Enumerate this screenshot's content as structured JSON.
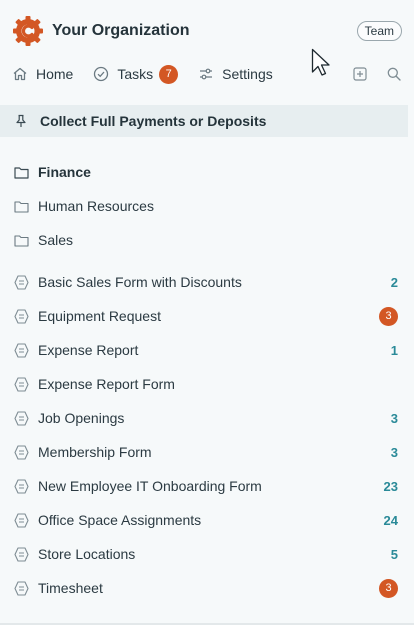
{
  "header": {
    "org_name": "Your Organization",
    "team_label": "Team",
    "brand_color": "#d35724"
  },
  "nav": {
    "home": "Home",
    "tasks": "Tasks",
    "tasks_count": "7",
    "settings": "Settings",
    "tools": [
      "add-icon",
      "search-icon"
    ]
  },
  "pinned": {
    "label": "Collect Full Payments or Deposits"
  },
  "folders": [
    {
      "label": "Finance",
      "active": true
    },
    {
      "label": "Human Resources",
      "active": false
    },
    {
      "label": "Sales",
      "active": false
    }
  ],
  "forms": [
    {
      "label": "Basic Sales Form with Discounts",
      "count": "2",
      "alert": false
    },
    {
      "label": "Equipment Request",
      "count": "3",
      "alert": true
    },
    {
      "label": "Expense Report",
      "count": "1",
      "alert": false
    },
    {
      "label": "Expense Report Form",
      "count": "",
      "alert": false
    },
    {
      "label": "Job Openings",
      "count": "3",
      "alert": false
    },
    {
      "label": "Membership Form",
      "count": "3",
      "alert": false
    },
    {
      "label": "New Employee IT Onboarding Form",
      "count": "23",
      "alert": false
    },
    {
      "label": "Office Space Assignments",
      "count": "24",
      "alert": false
    },
    {
      "label": "Store Locations",
      "count": "5",
      "alert": false
    },
    {
      "label": "Timesheet",
      "count": "3",
      "alert": true
    }
  ]
}
